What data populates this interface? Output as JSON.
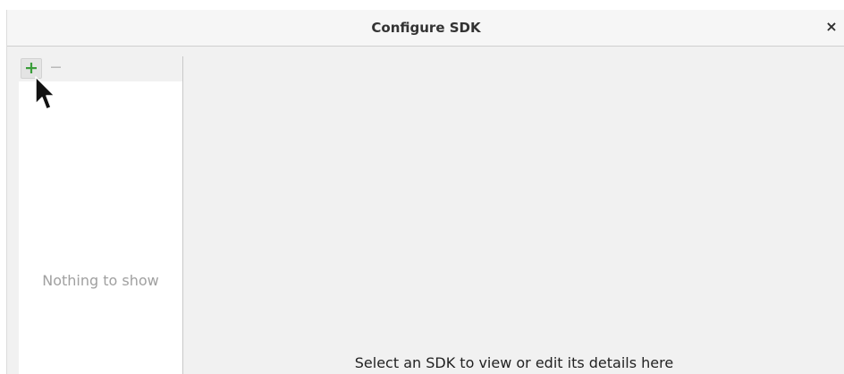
{
  "window": {
    "title": "Configure SDK",
    "close_label": "×"
  },
  "sidebar": {
    "add_icon": "plus-icon",
    "remove_icon": "minus-icon",
    "empty_text": "Nothing to show"
  },
  "details": {
    "hint": "Select an SDK to view or edit its details here"
  },
  "colors": {
    "add_icon": "#3a9d3a",
    "remove_icon": "#b5b5b5"
  }
}
